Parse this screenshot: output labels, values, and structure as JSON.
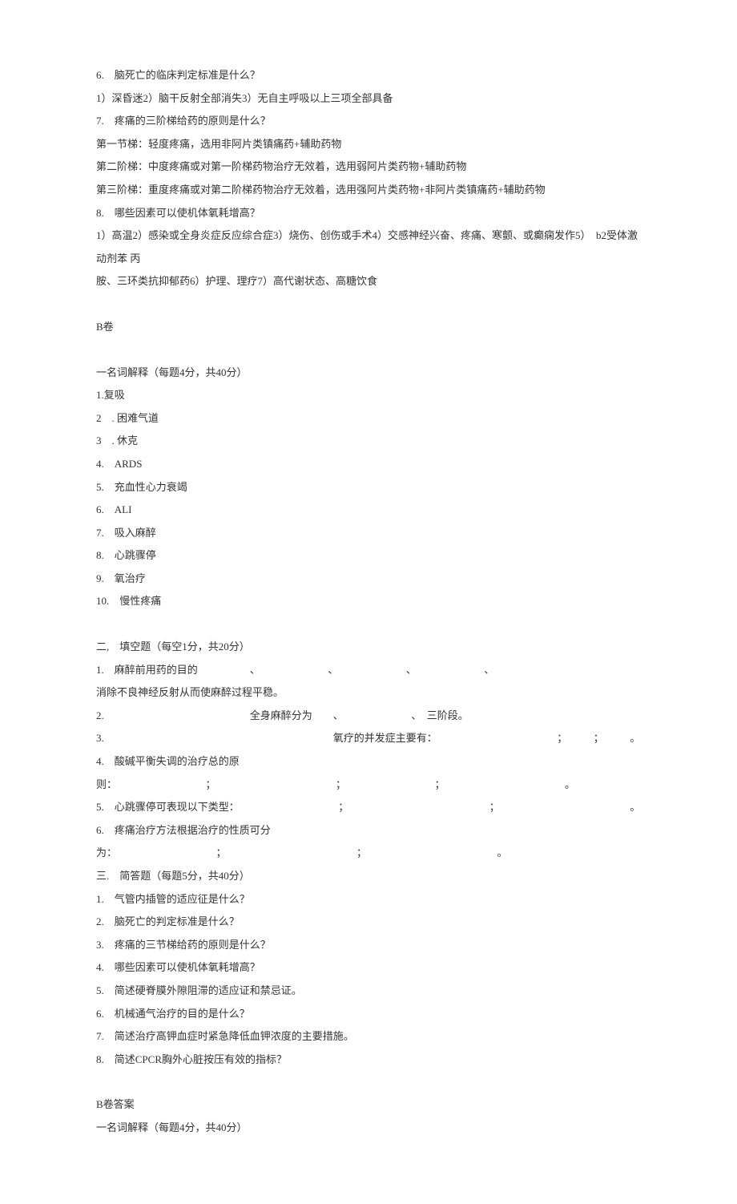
{
  "q6": {
    "question": "6.　脑死亡的临床判定标准是什么？",
    "answer": "1）深昏迷2）脑干反射全部消失3）无自主呼吸以上三项全部具备"
  },
  "q7": {
    "question": "7.　疼痛的三阶梯给药的原则是什么？",
    "line1": "第一节梯：轻度疼痛，选用非阿片类镇痛药+辅助药物",
    "line2": "第二阶梯：中度疼痛或对第一阶梯药物治疗无效着，选用弱阿片类药物+辅助药物",
    "line3": "第三阶梯：重度疼痛或对第二阶梯药物治疗无效着，选用强阿片类药物+非阿片类镇痛药+辅助药物"
  },
  "q8": {
    "question": "8.　哪些因素可以使机体氧耗增高？",
    "answer1": "1）高温2）感染或全身炎症反应综合症3）烧伤、创伤或手术4）交感神经兴奋、疼痛、寒颤、或癫痫发作5）　b2受体激动剂苯 丙",
    "answer2": "胺、三环类抗抑郁药6）护理、理疗7）高代谢状态、高糖饮食"
  },
  "sectionB": {
    "title": "B卷",
    "part1_title": "一名词解释（每题4分，共40分）",
    "items": [
      "1.复吸",
      "2　. 困难气道",
      "3　. 休克",
      "4.　ARDS",
      "5.　充血性心力衰竭",
      "6.　ALI",
      "7.　吸入麻醉",
      "8.　心跳骤停",
      "9.　氧治疗",
      "10.　慢性疼痛"
    ],
    "part2_title": "二,　填空题（每空1分，共20分）",
    "fill1_a": "1.　麻醉前用药的目的　　　　　、　　　　　　　、　　　　　　　、　　　　　　　、",
    "fill1_b": "消除不良神经反射从而使麻醉过程平稳。",
    "fill2": "2.　　　　　　　　　　　　　　全身麻醉分为　　、　　　　　　　、　三阶段。",
    "fill3": "3.　　　　　　　　　　　　　　　　　　　　　　氧疗的并发症主要有：　　　　　　　　　　　　；　　　；　　　。",
    "fill4_a": "4.　酸碱平衡失调的治疗总的原",
    "fill4_b": "则：　　　　　　　　　；　　　　　　　　　　　　；　　　　　　　　　；　　　　　　　　　　　　。",
    "fill5": "5.　心跳骤停可表现以下类型：　　　　　　　　　　；　　　　　　　　　　　　　　；　　　　　　　　　　　　　。",
    "fill6_a": "6.　疼痛治疗方法根据治疗的性质可分",
    "fill6_b": "为：　　　　　　　　　　；　　　　　　　　　　　　　；　　　　　　　　　　　　　。",
    "part3_title": "三.　简答题（每题5分，共40分）",
    "sq": [
      "1.　气管内插管的适应征是什么？",
      "2.　脑死亡的判定标准是什么？",
      "3.　疼痛的三节梯给药的原则是什么？",
      "4.　哪些因素可以使机体氧耗增高？",
      "5.　简述硬脊膜外隙阻滞的适应证和禁忌证。",
      "6.　机械通气治疗的目的是什么？",
      "7.　简述治疗高钾血症时紧急降低血钾浓度的主要措施。",
      "8.　简述CPCR胸外心脏按压有效的指标？"
    ],
    "answerB_title": "B卷答案",
    "answerB_sub": "一名词解释（每题4分，共40分）"
  }
}
